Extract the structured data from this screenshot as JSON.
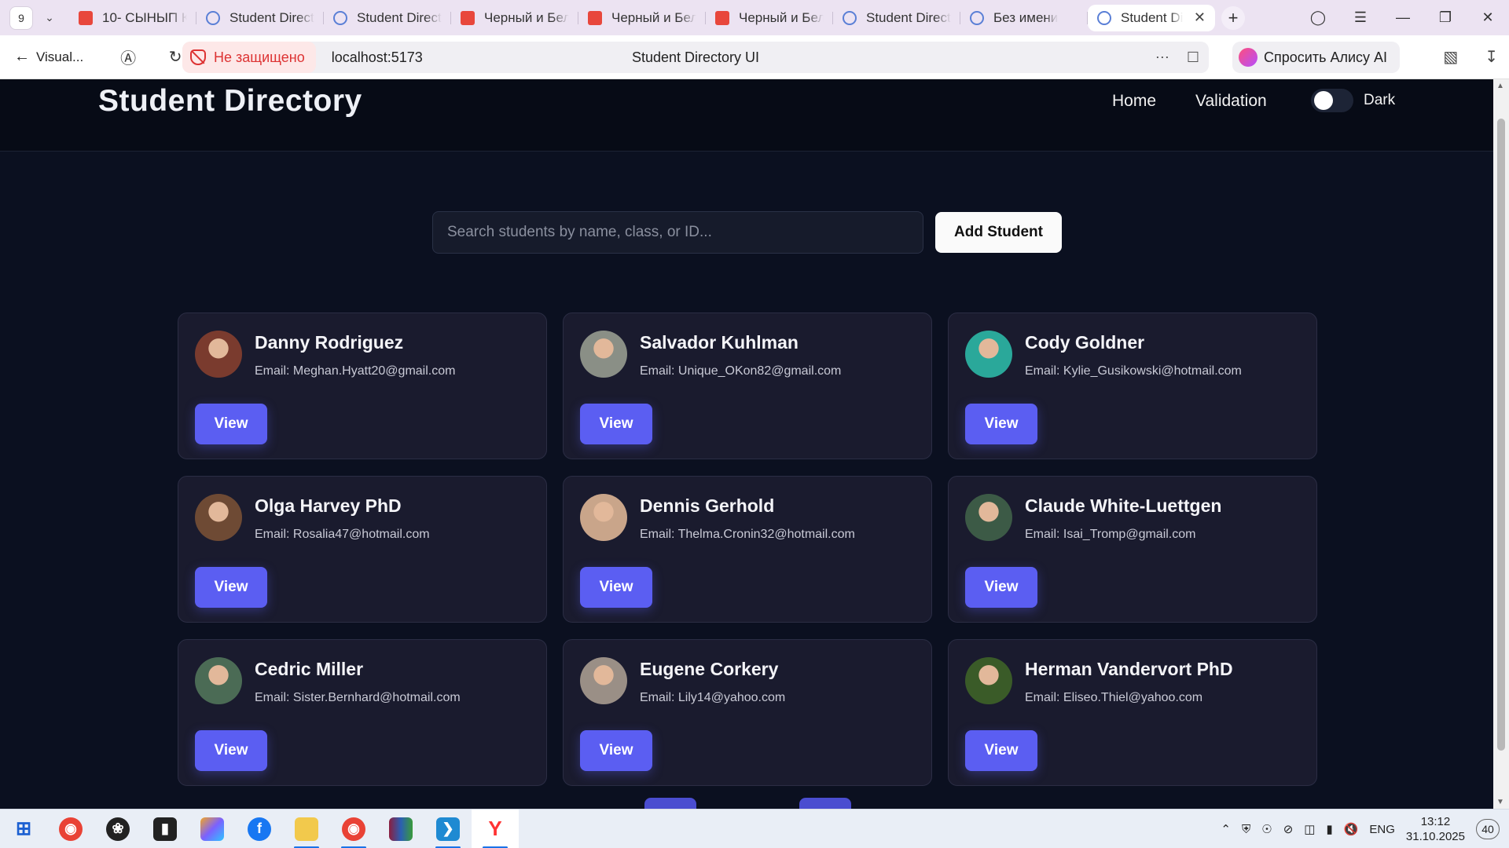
{
  "browser": {
    "tab_count": "9",
    "tabs": [
      {
        "label": "10- СЫНЫП К",
        "icon": "red-doc-icon"
      },
      {
        "label": "Student Direct",
        "icon": "react-icon"
      },
      {
        "label": "Student Direct",
        "icon": "react-icon"
      },
      {
        "label": "Черный и Бел",
        "icon": "red-doc-icon"
      },
      {
        "label": "Черный и Бел",
        "icon": "red-doc-icon"
      },
      {
        "label": "Черный и Бел",
        "icon": "red-doc-icon"
      },
      {
        "label": "Student Direct",
        "icon": "react-icon"
      },
      {
        "label": "Без имени",
        "icon": "react-icon"
      },
      {
        "label": "Student Di",
        "icon": "react-icon",
        "active": true
      }
    ],
    "back_label": "Visual...",
    "insecure_label": "Не защищено",
    "url": "localhost:5173",
    "page_title": "Student Directory UI",
    "alice_label": "Спросить Алису AI"
  },
  "header": {
    "brand": "Student Directory",
    "nav": [
      "Home",
      "Validation"
    ],
    "toggle_label": "Dark"
  },
  "search": {
    "placeholder": "Search students by name, class, or ID...",
    "value": "",
    "add_button": "Add Student"
  },
  "students": [
    {
      "name": "Danny Rodriguez",
      "email": "Email: Meghan.Hyatt20@gmail.com",
      "avatar_color": "#7a3b2e"
    },
    {
      "name": "Salvador Kuhlman",
      "email": "Email: Unique_OKon82@gmail.com",
      "avatar_color": "#8a8f86"
    },
    {
      "name": "Cody Goldner",
      "email": "Email: Kylie_Gusikowski@hotmail.com",
      "avatar_color": "#2aa89a"
    },
    {
      "name": "Olga Harvey PhD",
      "email": "Email: Rosalia47@hotmail.com",
      "avatar_color": "#6e4a34"
    },
    {
      "name": "Dennis Gerhold",
      "email": "Email: Thelma.Cronin32@hotmail.com",
      "avatar_color": "#c9a58a"
    },
    {
      "name": "Claude White-Luettgen",
      "email": "Email: Isai_Tromp@gmail.com",
      "avatar_color": "#3c5a46"
    },
    {
      "name": "Cedric Miller",
      "email": "Email: Sister.Bernhard@hotmail.com",
      "avatar_color": "#4b6b55"
    },
    {
      "name": "Eugene Corkery",
      "email": "Email: Lily14@yahoo.com",
      "avatar_color": "#9a8f86"
    },
    {
      "name": "Herman Vandervort PhD",
      "email": "Email: Eliseo.Thiel@yahoo.com",
      "avatar_color": "#3a5b28"
    }
  ],
  "view_label": "View",
  "taskbar": {
    "lang": "ENG",
    "time": "13:12",
    "date": "31.10.2025",
    "notifications": "40"
  }
}
